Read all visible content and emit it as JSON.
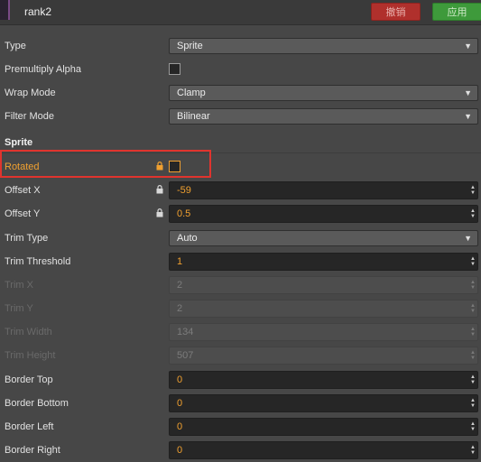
{
  "header": {
    "title": "rank2",
    "cancel_label": "撤销",
    "apply_label": "应用"
  },
  "fields": {
    "type": {
      "label": "Type",
      "value": "Sprite"
    },
    "premultiply": {
      "label": "Premultiply Alpha",
      "checked": false
    },
    "wrap": {
      "label": "Wrap Mode",
      "value": "Clamp"
    },
    "filter": {
      "label": "Filter Mode",
      "value": "Bilinear"
    },
    "sprite_section": "Sprite",
    "rotated": {
      "label": "Rotated",
      "checked": false
    },
    "offset_x": {
      "label": "Offset X",
      "value": "-59"
    },
    "offset_y": {
      "label": "Offset Y",
      "value": "0.5"
    },
    "trim_type": {
      "label": "Trim Type",
      "value": "Auto"
    },
    "trim_threshold": {
      "label": "Trim Threshold",
      "value": "1"
    },
    "trim_x": {
      "label": "Trim X",
      "value": "2"
    },
    "trim_y": {
      "label": "Trim Y",
      "value": "2"
    },
    "trim_width": {
      "label": "Trim Width",
      "value": "134"
    },
    "trim_height": {
      "label": "Trim Height",
      "value": "507"
    },
    "border_top": {
      "label": "Border Top",
      "value": "0"
    },
    "border_bottom": {
      "label": "Border Bottom",
      "value": "0"
    },
    "border_left": {
      "label": "Border Left",
      "value": "0"
    },
    "border_right": {
      "label": "Border Right",
      "value": "0"
    }
  },
  "icons": {
    "dropdown": "chevron-down-icon",
    "lock": "lock-icon",
    "spinner": "spinner-arrows-icon"
  },
  "colors": {
    "accent": "#f0a030",
    "cancel": "#b0302c",
    "apply": "#3e9a3b",
    "highlight_box": "#e0342e"
  }
}
